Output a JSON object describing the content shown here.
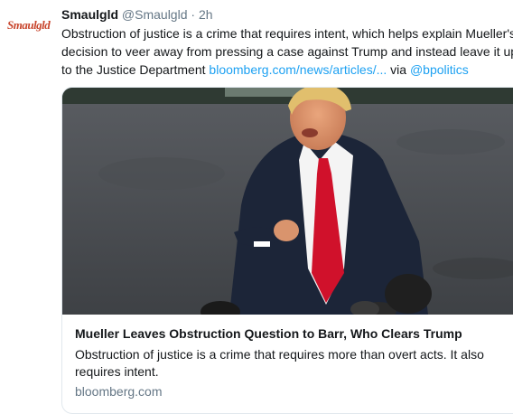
{
  "tweet": {
    "avatar_text": "Smaulgld",
    "name": "Smaulgld",
    "handle": "@Smaulgld",
    "separator": "·",
    "time": "2h",
    "line1": "Obstruction of justice is a crime that requires intent, which helps explain Mueller's",
    "line2": "decision to veer away from pressing a case against Trump and instead leave it up",
    "line3_text": "to the Justice Department ",
    "link": "bloomberg.com/news/articles/...",
    "via": " via ",
    "mention": "@bpolitics"
  },
  "card": {
    "title": "Mueller Leaves Obstruction Question to Barr, Who Clears Trump",
    "description": "Obstruction of justice is a crime that requires more than overt acts. It also requires intent.",
    "domain": "bloomberg.com"
  },
  "colors": {
    "link": "#1da1f2",
    "muted": "#657786",
    "avatar": "#c8452c"
  }
}
